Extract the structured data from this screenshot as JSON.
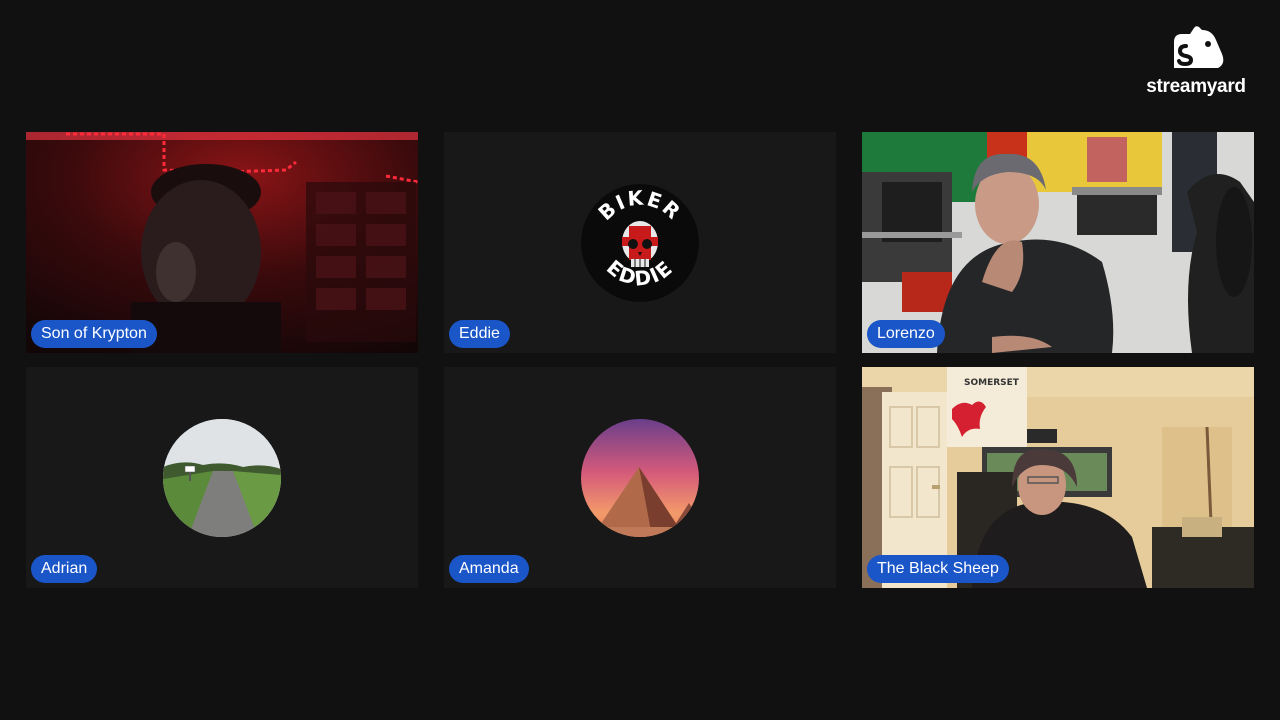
{
  "brand": {
    "name": "streamyard",
    "icon": "streamyard-logo-icon"
  },
  "tiles": [
    {
      "name": "Son of Krypton",
      "type": "video"
    },
    {
      "name": "Eddie",
      "type": "avatar",
      "avatar_text_top": "BIKER",
      "avatar_text_bottom": "EDDIE"
    },
    {
      "name": "Lorenzo",
      "type": "video"
    },
    {
      "name": "Adrian",
      "type": "avatar"
    },
    {
      "name": "Amanda",
      "type": "avatar"
    },
    {
      "name": "The Black Sheep",
      "type": "video",
      "flag_text": "SOMERSET"
    }
  ],
  "colors": {
    "background": "#111111",
    "tile": "#181818",
    "name_pill": "#1a56c8"
  }
}
